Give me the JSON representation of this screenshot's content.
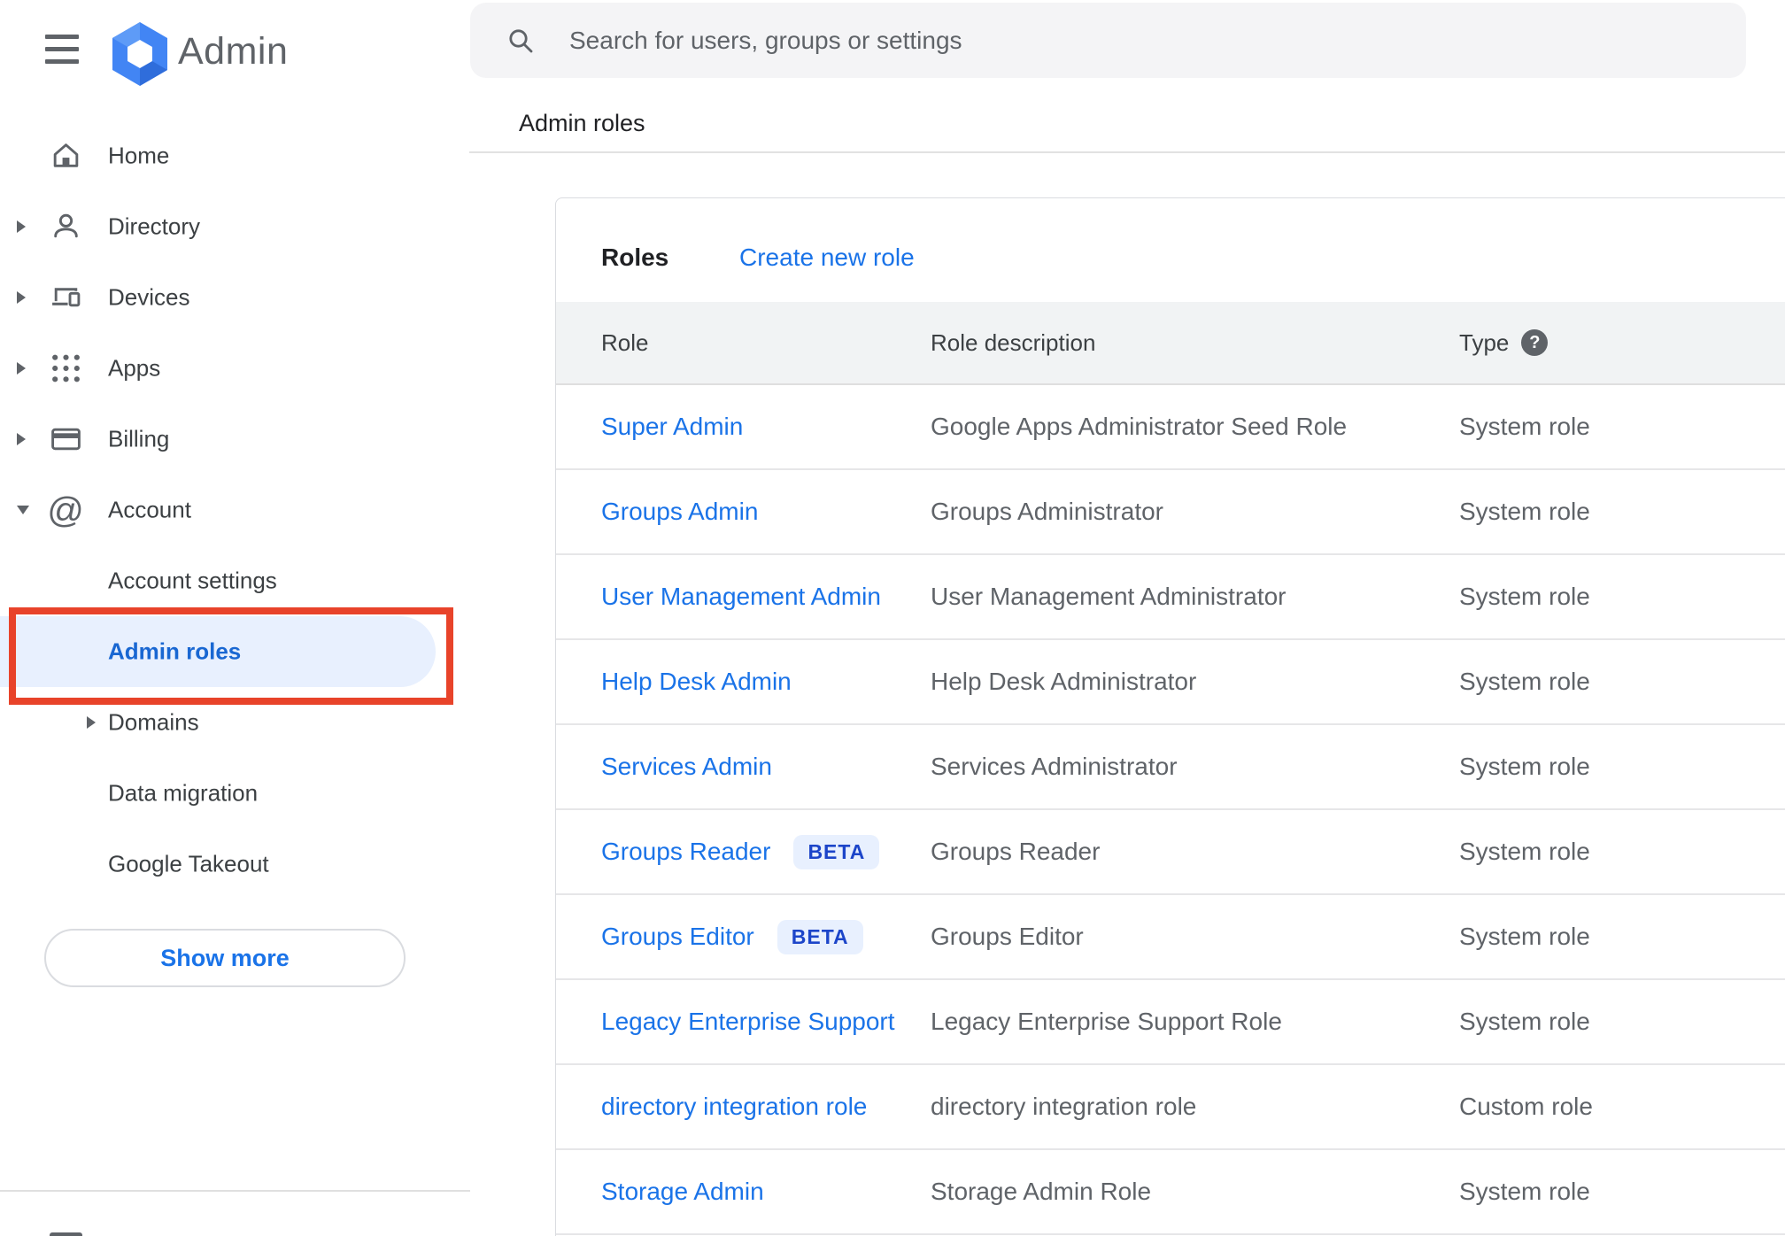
{
  "header": {
    "product_name": "Admin",
    "search": {
      "placeholder": "Search for users, groups or settings"
    },
    "breadcrumb": "Admin roles",
    "icons": [
      "menu-icon",
      "google-admin-hexagon-logo",
      "search-icon"
    ]
  },
  "sidebar": {
    "entries": [
      {
        "label": "Home",
        "icon": "home-icon",
        "expander": "none",
        "level": 0
      },
      {
        "label": "Directory",
        "icon": "person-icon",
        "expander": "collapsed",
        "level": 0
      },
      {
        "label": "Devices",
        "icon": "devices-icon",
        "expander": "collapsed",
        "level": 0
      },
      {
        "label": "Apps",
        "icon": "apps-grid-icon",
        "expander": "collapsed",
        "level": 0
      },
      {
        "label": "Billing",
        "icon": "credit-card-icon",
        "expander": "collapsed",
        "level": 0
      },
      {
        "label": "Account",
        "icon": "at-sign-icon",
        "expander": "expanded",
        "level": 0
      },
      {
        "label": "Account settings",
        "icon": "",
        "expander": "none",
        "level": 1
      },
      {
        "label": "Admin roles",
        "icon": "",
        "expander": "none",
        "level": 1,
        "selected": true
      },
      {
        "label": "Domains",
        "icon": "",
        "expander": "collapsed",
        "level": 1
      },
      {
        "label": "Data migration",
        "icon": "",
        "expander": "none",
        "level": 1
      },
      {
        "label": "Google Takeout",
        "icon": "",
        "expander": "none",
        "level": 1
      }
    ],
    "show_more_label": "Show more"
  },
  "main": {
    "card_title": "Roles",
    "create_link": "Create new role",
    "columns": [
      "Role",
      "Role description",
      "Type"
    ],
    "help_icon": "help-question-icon",
    "beta_label": "BETA",
    "rows": [
      {
        "role": "Super Admin",
        "beta": false,
        "description": "Google Apps Administrator Seed Role",
        "type": "System role"
      },
      {
        "role": "Groups Admin",
        "beta": false,
        "description": "Groups Administrator",
        "type": "System role"
      },
      {
        "role": "User Management Admin",
        "beta": false,
        "description": "User Management Administrator",
        "type": "System role"
      },
      {
        "role": "Help Desk Admin",
        "beta": false,
        "description": "Help Desk Administrator",
        "type": "System role"
      },
      {
        "role": "Services Admin",
        "beta": false,
        "description": "Services Administrator",
        "type": "System role"
      },
      {
        "role": "Groups Reader",
        "beta": true,
        "description": "Groups Reader",
        "type": "System role"
      },
      {
        "role": "Groups Editor",
        "beta": true,
        "description": "Groups Editor",
        "type": "System role"
      },
      {
        "role": "Legacy Enterprise Support",
        "beta": false,
        "description": "Legacy Enterprise Support Role",
        "type": "System role"
      },
      {
        "role": "directory integration role",
        "beta": false,
        "description": "directory integration role",
        "type": "Custom role"
      },
      {
        "role": "Storage Admin",
        "beta": false,
        "description": "Storage Admin Role",
        "type": "System role"
      }
    ]
  },
  "annotation": {
    "type": "highlight-box",
    "color": "#e8432a",
    "target": "Admin roles"
  },
  "colors": {
    "accent_blue": "#1a73e8",
    "selected_item_blue": "#1967d2",
    "selected_item_bg": "#e8f0fe",
    "beta_badge_bg": "#e8f0fe",
    "beta_badge_text": "#1c45c9",
    "table_header_bg": "#f1f3f4",
    "annotation_red": "#e8432a",
    "icon_gray": "#5f6368"
  }
}
